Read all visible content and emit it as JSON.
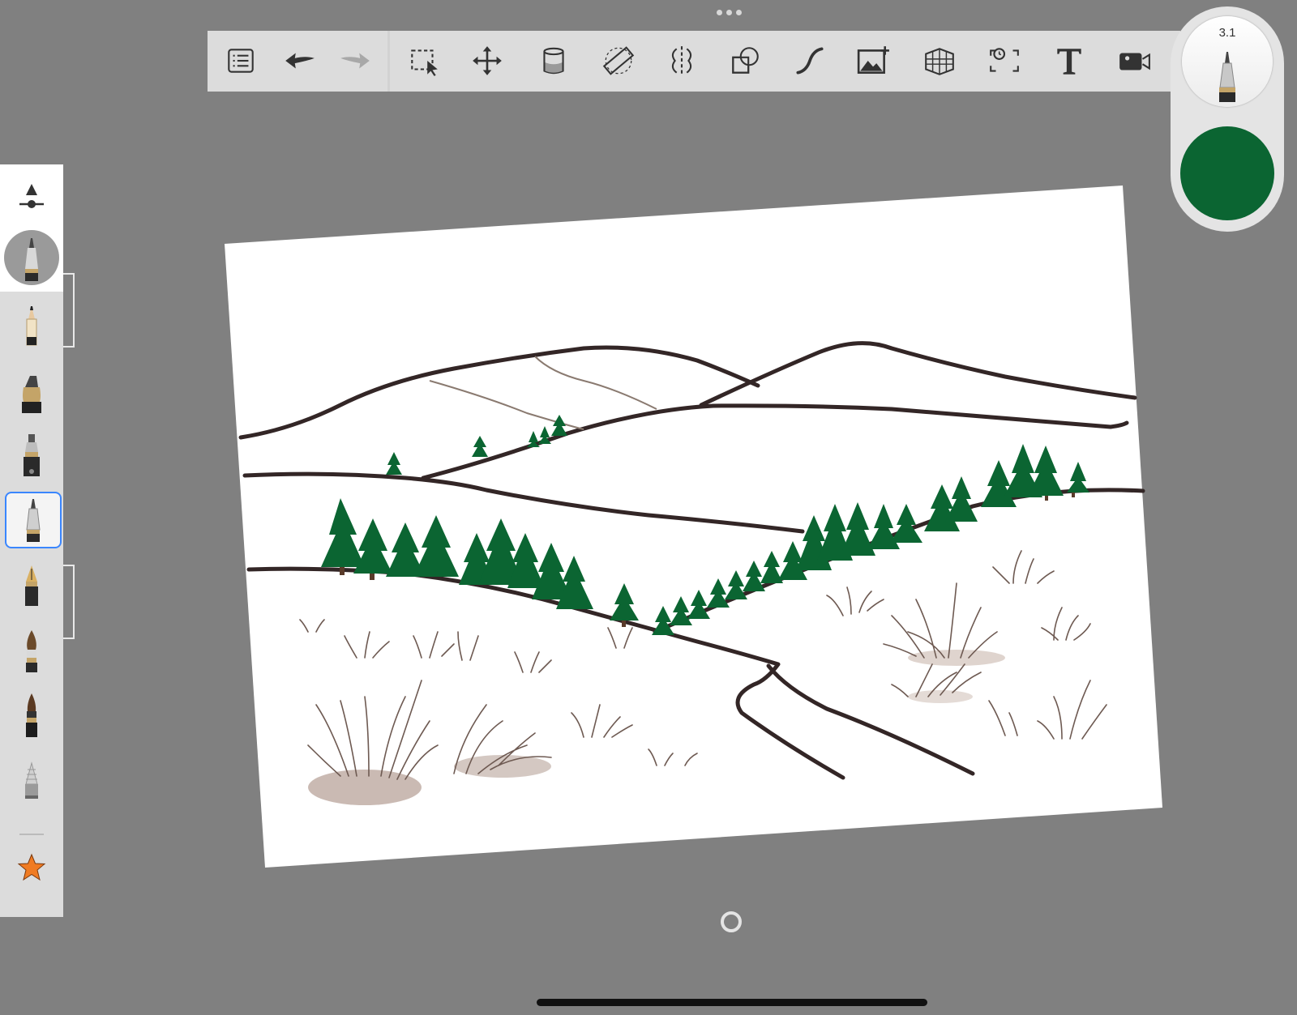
{
  "toolbar": {
    "items": [
      {
        "name": "layers-list-icon"
      },
      {
        "name": "undo-icon"
      },
      {
        "name": "redo-icon"
      },
      {
        "name": "selection-icon"
      },
      {
        "name": "transform-icon"
      },
      {
        "name": "fill-icon"
      },
      {
        "name": "ruler-icon"
      },
      {
        "name": "symmetry-icon"
      },
      {
        "name": "shapes-icon"
      },
      {
        "name": "curve-icon"
      },
      {
        "name": "import-image-icon"
      },
      {
        "name": "perspective-grid-icon"
      },
      {
        "name": "time-lapse-icon"
      },
      {
        "name": "text-icon"
      },
      {
        "name": "video-icon"
      }
    ]
  },
  "puck": {
    "brush_size": "3.1",
    "color": "#0b6532"
  },
  "sidebar": {
    "brushes": [
      "pencil",
      "ink-pen",
      "technical-pen",
      "ballpoint-pen",
      "fountain-pen",
      "brush",
      "marker",
      "airbrush"
    ],
    "favorites": "star-icon"
  },
  "colors": {
    "tree_green": "#0b6532",
    "outline": "#332626",
    "grass": "#6e5a52"
  }
}
